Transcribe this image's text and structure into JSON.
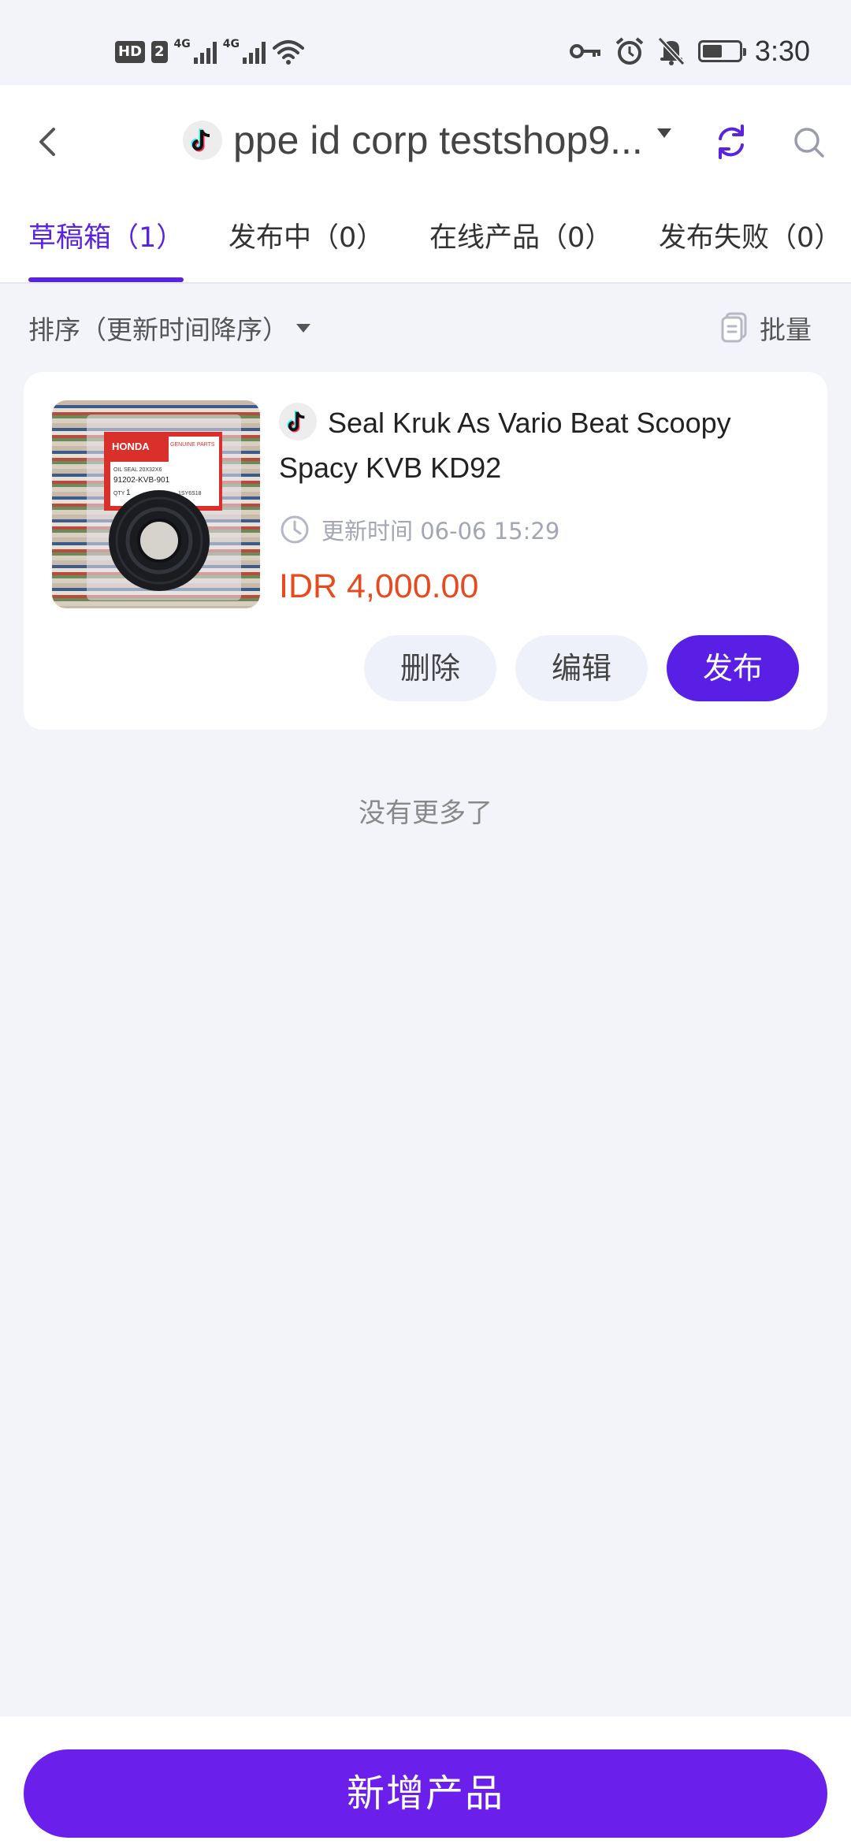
{
  "status_bar": {
    "badge_hd": "HD",
    "badge_sim": "2",
    "net1": "4G",
    "net2": "4G",
    "time": "3:30",
    "battery_level": 0.55
  },
  "header": {
    "shop_name": "ppe id corp testshop9...",
    "accent_color": "#5a24dc"
  },
  "tabs": [
    {
      "label": "草稿箱（1）",
      "active": true
    },
    {
      "label": "发布中（0）",
      "active": false
    },
    {
      "label": "在线产品（0）",
      "active": false
    },
    {
      "label": "发布失败（0）",
      "active": false
    }
  ],
  "toolbar": {
    "sort_label": "排序（更新时间降序）",
    "batch_label": "批量"
  },
  "products": [
    {
      "title": "Seal Kruk As Vario Beat Scoopy Spacy KVB KD92",
      "update_time": "更新时间 06-06 15:29",
      "price": "IDR 4,000.00",
      "price_color": "#e84a1f",
      "thumb_text": {
        "brand": "HONDA",
        "tag": "GENUINE PARTS",
        "desc": "OIL SEAL 20X32X6",
        "part_no": "91202-KVB-901",
        "qty_label": "QTY",
        "qty_value": "1",
        "code": "1SY6S18"
      },
      "actions": {
        "delete": "删除",
        "edit": "编辑",
        "publish": "发布"
      }
    }
  ],
  "list_end_text": "没有更多了",
  "bottom": {
    "add_product_label": "新增产品"
  }
}
